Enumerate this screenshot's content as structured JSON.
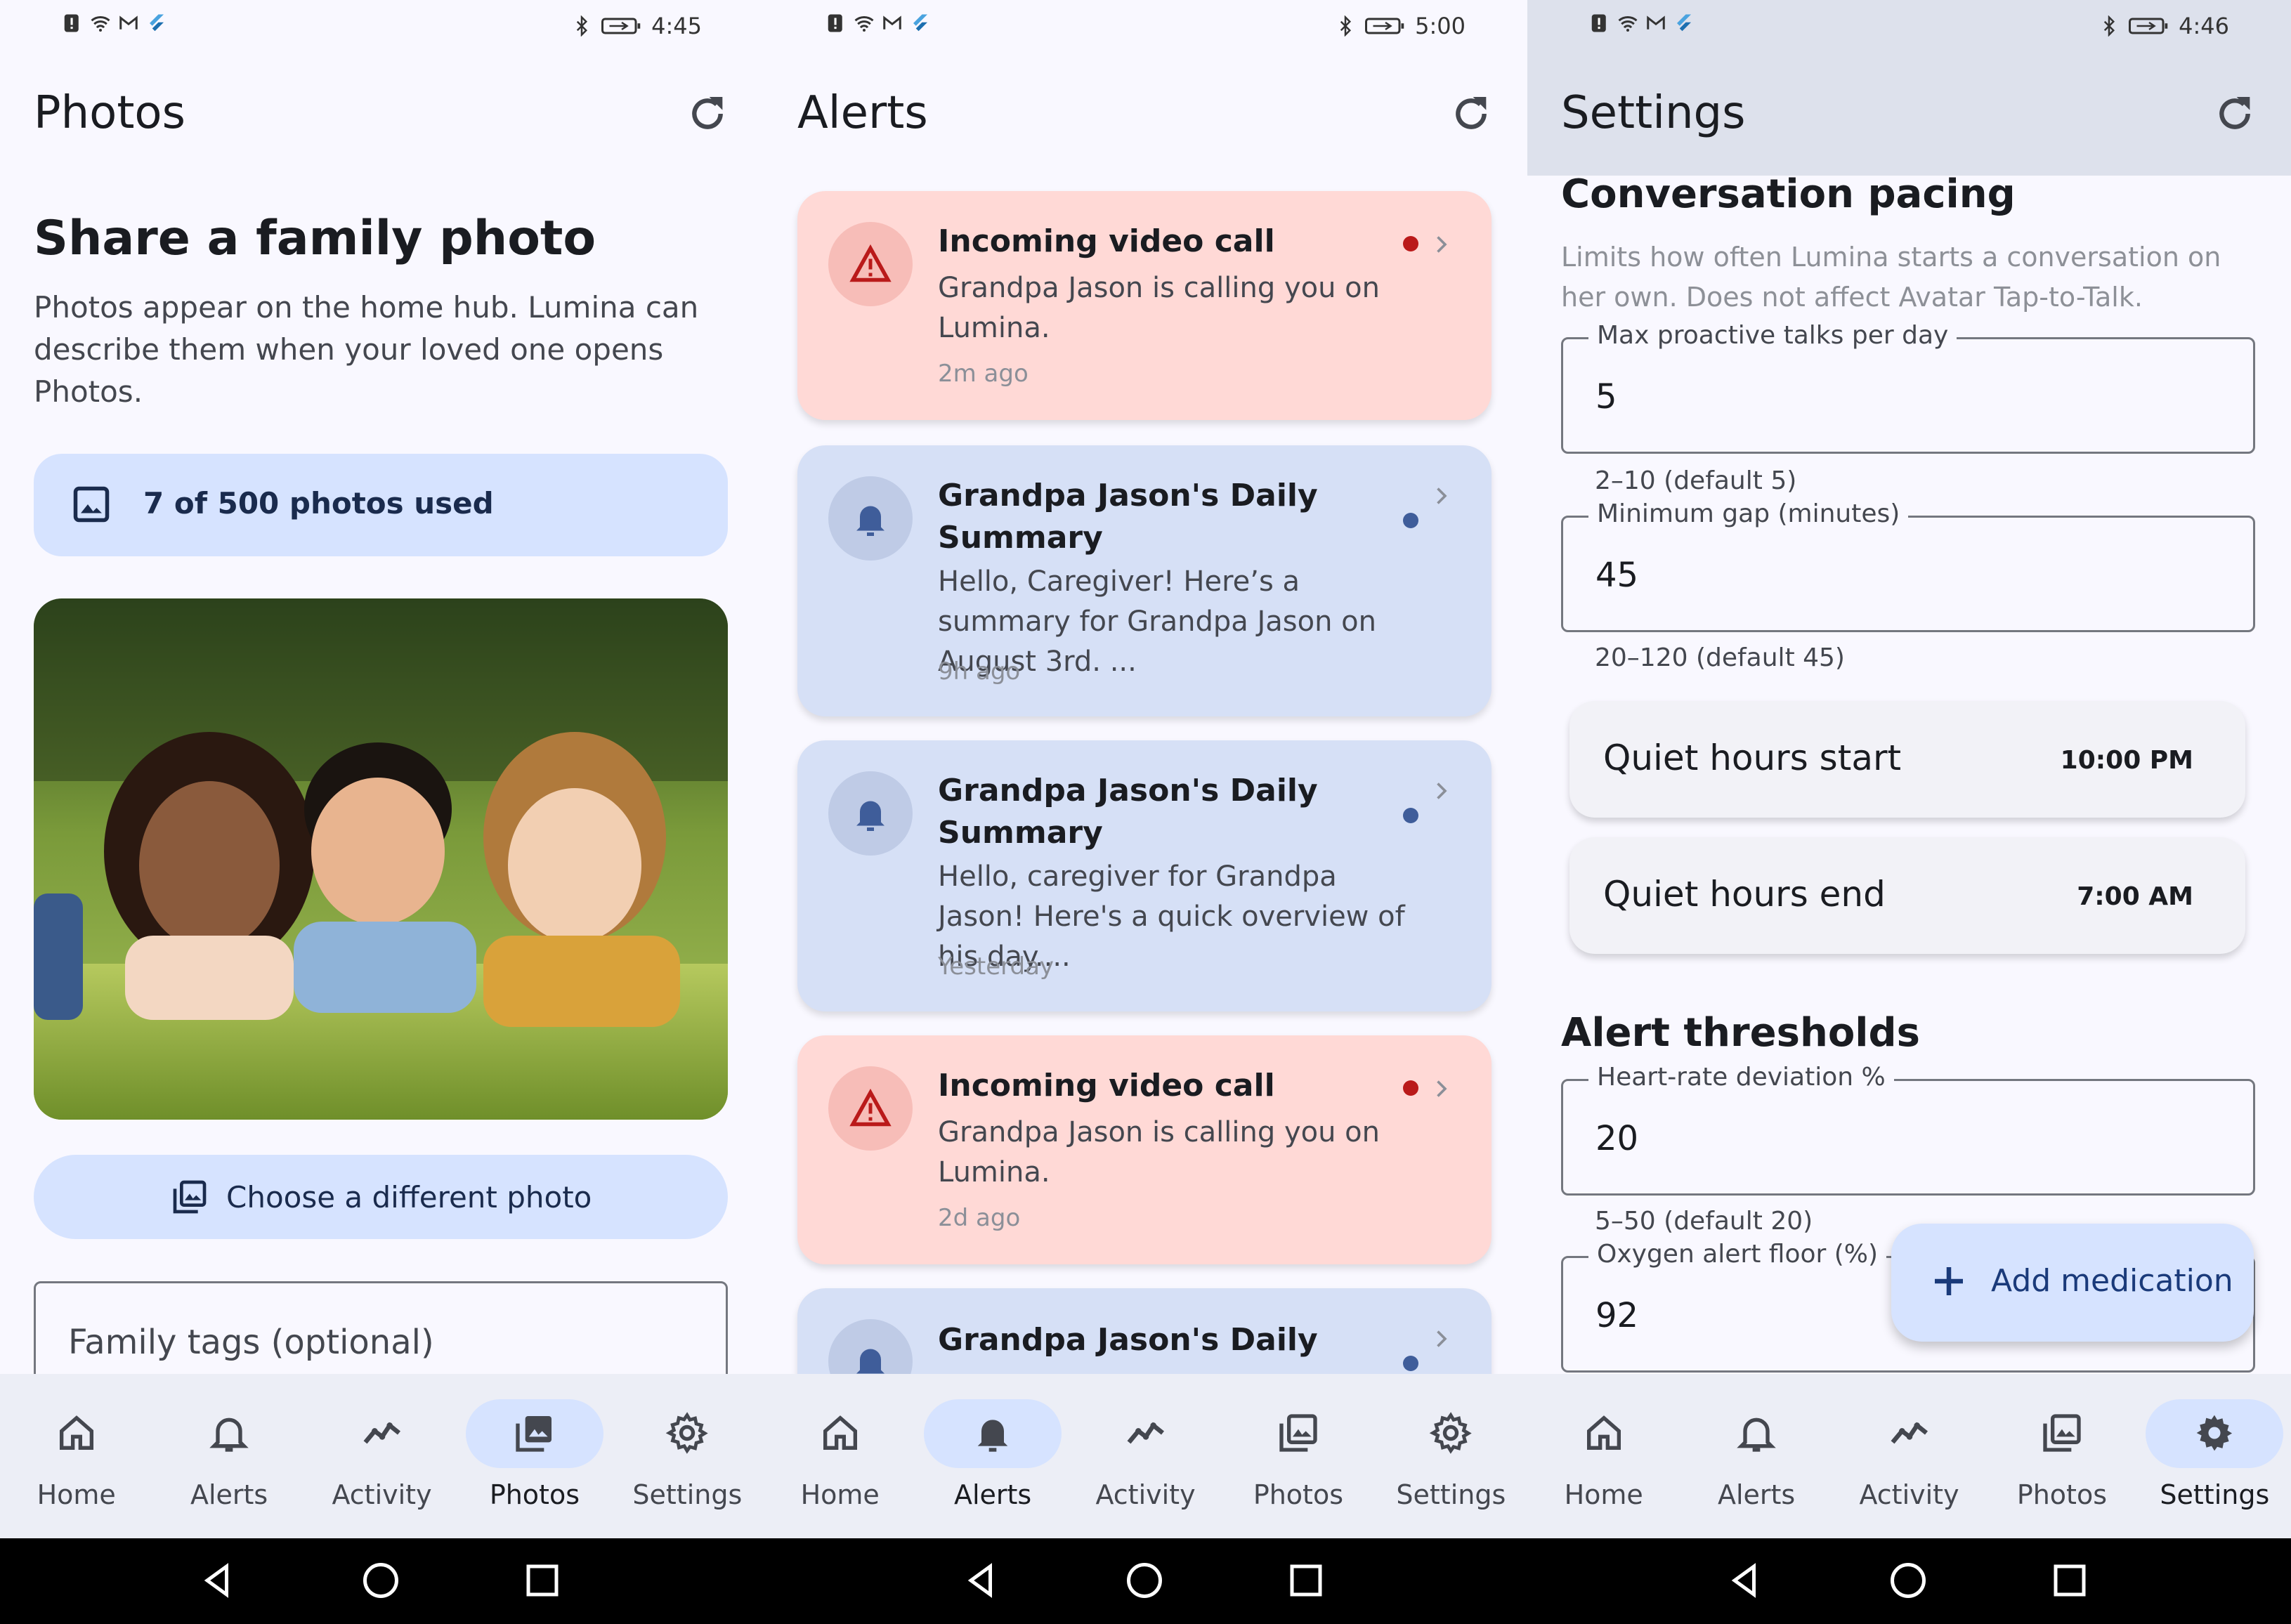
{
  "photos_screen": {
    "status_time": "4:45",
    "title": "Photos",
    "heading": "Share a family photo",
    "description": "Photos appear on the home hub. Lumina can describe them when your loved one opens Photos.",
    "usage_text": "7 of 500 photos used",
    "choose_button": "Choose a different photo",
    "tags_placeholder": "Family tags (optional)"
  },
  "alerts_screen": {
    "status_time": "5:00",
    "title": "Alerts",
    "alerts": [
      {
        "title": "Incoming video call",
        "body": "Grandpa Jason is calling you on Lumina.",
        "time": "2m ago",
        "kind": "warning"
      },
      {
        "title": "Grandpa Jason's Daily Summary",
        "body": "Hello, Caregiver! Here’s a summary for Grandpa Jason on August 3rd. ...",
        "time": "9h ago",
        "kind": "info"
      },
      {
        "title": "Grandpa Jason's Daily Summary",
        "body": "Hello, caregiver for Grandpa Jason! Here's a quick overview of his day....",
        "time": "Yesterday",
        "kind": "info"
      },
      {
        "title": "Incoming video call",
        "body": "Grandpa Jason is calling you on Lumina.",
        "time": "2d ago",
        "kind": "warning"
      },
      {
        "title": "Grandpa Jason's Daily",
        "body": "",
        "time": "",
        "kind": "info"
      }
    ]
  },
  "settings_screen": {
    "status_time": "4:46",
    "title": "Settings",
    "conversation_section": "Conversation pacing",
    "conversation_help": "Limits how often Lumina starts a conversation on her own. Does not affect Avatar Tap-to-Talk.",
    "max_talks_label": "Max proactive talks per day",
    "max_talks_value": "5",
    "max_talks_hint": "2–10 (default 5)",
    "min_gap_label": "Minimum gap (minutes)",
    "min_gap_value": "45",
    "min_gap_hint": "20–120 (default 45)",
    "quiet_start_label": "Quiet hours start",
    "quiet_start_value": "10:00 PM",
    "quiet_end_label": "Quiet hours end",
    "quiet_end_value": "7:00 AM",
    "alert_section": "Alert thresholds",
    "hr_label": "Heart-rate deviation %",
    "hr_value": "20",
    "hr_hint": "5–50 (default 20)",
    "oxygen_label": "Oxygen alert floor (%)",
    "oxygen_value": "92",
    "fab_label": "Add medication"
  },
  "nav": {
    "home": "Home",
    "alerts": "Alerts",
    "activity": "Activity",
    "photos": "Photos",
    "settings": "Settings"
  },
  "colors": {
    "background": "#f9f8ff",
    "primary_container": "#d6e3ff",
    "alert_red_container": "#ffd9d6",
    "alert_blue_container": "#d6e0f6",
    "error_red": "#ba1a1a"
  }
}
